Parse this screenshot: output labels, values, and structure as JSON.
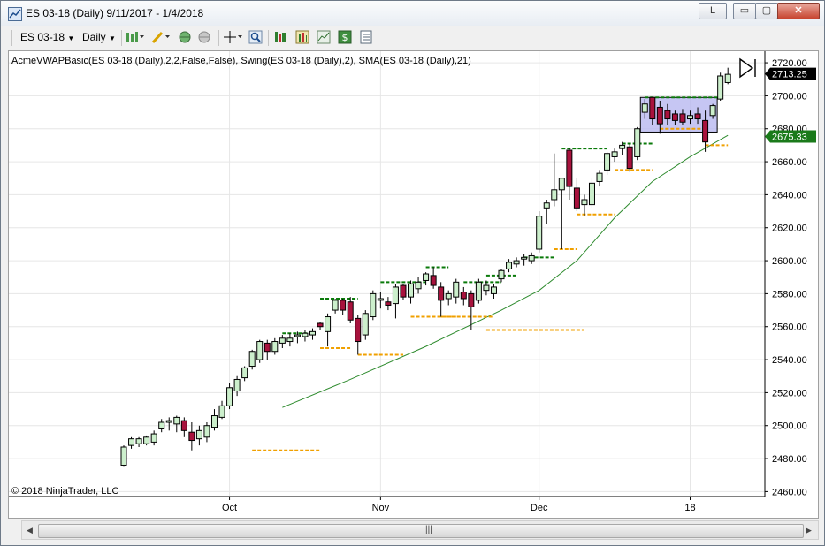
{
  "window": {
    "title": "ES 03-18 (Daily)  9/11/2017 - 1/4/2018",
    "link_button_label": "L",
    "minimize_label": "▭",
    "maximize_label": "▢",
    "close_label": "✕"
  },
  "toolbar": {
    "instrument": "ES 03-18",
    "interval": "Daily",
    "icons": [
      "bars-type-icon",
      "draw-pencil-icon",
      "globe-icon",
      "globe-gray-icon",
      "crosshair-icon",
      "zoom-icon",
      "strategy-icon",
      "properties-icon",
      "chart-trader-icon",
      "dollar-icon",
      "data-box-icon"
    ]
  },
  "chart": {
    "indicator_label": "AcmeVWAPBasic(ES 03-18 (Daily),2,2,False,False), Swing(ES 03-18 (Daily),2), SMA(ES 03-18 (Daily),21)",
    "copyright": "© 2018 NinjaTrader, LLC",
    "last_price_label": "2713.25",
    "sma_price_label": "2675.33",
    "colors": {
      "up_candle": "#ccefcc",
      "down_candle": "#a8123d",
      "swing_high": "#0a7a0a",
      "swing_low": "#f0a000",
      "sma": "#2e8b2e",
      "price_box": "#000000",
      "sma_box": "#1a7a1a",
      "highlight_rect": "#b8b8f0"
    }
  },
  "chart_data": {
    "type": "candlestick",
    "instrument": "ES 03-18",
    "interval": "Daily",
    "x_tick_labels": [
      "Oct",
      "Nov",
      "Dec",
      "18"
    ],
    "y_ticks": [
      2460,
      2480,
      2500,
      2520,
      2540,
      2560,
      2580,
      2600,
      2620,
      2640,
      2660,
      2680,
      2700,
      2720
    ],
    "y_tick_labels": [
      "2460.00",
      "2480.00",
      "2500.00",
      "2520.00",
      "2540.00",
      "2560.00",
      "2580.00",
      "2600.00",
      "2620.00",
      "2640.00",
      "2660.00",
      "2680.00",
      "2700.00",
      "2720.00"
    ],
    "ylim": [
      2457,
      2727
    ],
    "bars": [
      {
        "o": 2476,
        "h": 2488,
        "l": 2475,
        "c": 2487
      },
      {
        "o": 2488,
        "h": 2493,
        "l": 2486,
        "c": 2492
      },
      {
        "o": 2489,
        "h": 2493,
        "l": 2487,
        "c": 2492
      },
      {
        "o": 2489,
        "h": 2494,
        "l": 2488,
        "c": 2493
      },
      {
        "o": 2490,
        "h": 2497,
        "l": 2488,
        "c": 2495
      },
      {
        "o": 2498,
        "h": 2504,
        "l": 2496,
        "c": 2502
      },
      {
        "o": 2502,
        "h": 2505,
        "l": 2497,
        "c": 2503
      },
      {
        "o": 2501,
        "h": 2506,
        "l": 2496,
        "c": 2505
      },
      {
        "o": 2503,
        "h": 2505,
        "l": 2493,
        "c": 2497
      },
      {
        "o": 2496,
        "h": 2502,
        "l": 2485,
        "c": 2491
      },
      {
        "o": 2492,
        "h": 2500,
        "l": 2488,
        "c": 2497
      },
      {
        "o": 2493,
        "h": 2502,
        "l": 2490,
        "c": 2500
      },
      {
        "o": 2499,
        "h": 2510,
        "l": 2497,
        "c": 2506
      },
      {
        "o": 2505,
        "h": 2515,
        "l": 2504,
        "c": 2512
      },
      {
        "o": 2512,
        "h": 2526,
        "l": 2510,
        "c": 2523
      },
      {
        "o": 2521,
        "h": 2530,
        "l": 2518,
        "c": 2528
      },
      {
        "o": 2529,
        "h": 2536,
        "l": 2527,
        "c": 2535
      },
      {
        "o": 2536,
        "h": 2546,
        "l": 2534,
        "c": 2545
      },
      {
        "o": 2540,
        "h": 2552,
        "l": 2538,
        "c": 2551
      },
      {
        "o": 2550,
        "h": 2552,
        "l": 2540,
        "c": 2545
      },
      {
        "o": 2545,
        "h": 2553,
        "l": 2543,
        "c": 2551
      },
      {
        "o": 2550,
        "h": 2555,
        "l": 2547,
        "c": 2553
      },
      {
        "o": 2551,
        "h": 2556,
        "l": 2548,
        "c": 2553
      },
      {
        "o": 2554,
        "h": 2557,
        "l": 2550,
        "c": 2555
      },
      {
        "o": 2554,
        "h": 2558,
        "l": 2551,
        "c": 2556
      },
      {
        "o": 2555,
        "h": 2559,
        "l": 2552,
        "c": 2557
      },
      {
        "o": 2562,
        "h": 2563,
        "l": 2558,
        "c": 2560
      },
      {
        "o": 2557,
        "h": 2568,
        "l": 2548,
        "c": 2566
      },
      {
        "o": 2570,
        "h": 2577,
        "l": 2568,
        "c": 2576
      },
      {
        "o": 2576,
        "h": 2577,
        "l": 2567,
        "c": 2570
      },
      {
        "o": 2575,
        "h": 2578,
        "l": 2562,
        "c": 2564
      },
      {
        "o": 2565,
        "h": 2567,
        "l": 2543,
        "c": 2551
      },
      {
        "o": 2555,
        "h": 2570,
        "l": 2552,
        "c": 2568
      },
      {
        "o": 2566,
        "h": 2582,
        "l": 2564,
        "c": 2580
      },
      {
        "o": 2576,
        "h": 2581,
        "l": 2571,
        "c": 2577
      },
      {
        "o": 2575,
        "h": 2578,
        "l": 2570,
        "c": 2573
      },
      {
        "o": 2574,
        "h": 2586,
        "l": 2565,
        "c": 2584
      },
      {
        "o": 2585,
        "h": 2586,
        "l": 2576,
        "c": 2578
      },
      {
        "o": 2578,
        "h": 2588,
        "l": 2574,
        "c": 2586
      },
      {
        "o": 2583,
        "h": 2590,
        "l": 2580,
        "c": 2587
      },
      {
        "o": 2588,
        "h": 2593,
        "l": 2585,
        "c": 2592
      },
      {
        "o": 2591,
        "h": 2596,
        "l": 2583,
        "c": 2585
      },
      {
        "o": 2584,
        "h": 2587,
        "l": 2566,
        "c": 2576
      },
      {
        "o": 2577,
        "h": 2582,
        "l": 2573,
        "c": 2580
      },
      {
        "o": 2578,
        "h": 2589,
        "l": 2574,
        "c": 2587
      },
      {
        "o": 2581,
        "h": 2584,
        "l": 2573,
        "c": 2577
      },
      {
        "o": 2580,
        "h": 2582,
        "l": 2558,
        "c": 2572
      },
      {
        "o": 2576,
        "h": 2589,
        "l": 2574,
        "c": 2587
      },
      {
        "o": 2582,
        "h": 2588,
        "l": 2579,
        "c": 2585
      },
      {
        "o": 2580,
        "h": 2586,
        "l": 2577,
        "c": 2584
      },
      {
        "o": 2589,
        "h": 2595,
        "l": 2587,
        "c": 2594
      },
      {
        "o": 2595,
        "h": 2601,
        "l": 2593,
        "c": 2599
      },
      {
        "o": 2598,
        "h": 2602,
        "l": 2596,
        "c": 2600
      },
      {
        "o": 2601,
        "h": 2604,
        "l": 2597,
        "c": 2602
      },
      {
        "o": 2600,
        "h": 2605,
        "l": 2598,
        "c": 2603
      },
      {
        "o": 2607,
        "h": 2630,
        "l": 2605,
        "c": 2627
      },
      {
        "o": 2632,
        "h": 2637,
        "l": 2622,
        "c": 2635
      },
      {
        "o": 2637,
        "h": 2665,
        "l": 2633,
        "c": 2643
      },
      {
        "o": 2643,
        "h": 2648,
        "l": 2607,
        "c": 2650
      },
      {
        "o": 2667,
        "h": 2668,
        "l": 2637,
        "c": 2645
      },
      {
        "o": 2644,
        "h": 2650,
        "l": 2630,
        "c": 2632
      },
      {
        "o": 2634,
        "h": 2640,
        "l": 2627,
        "c": 2637
      },
      {
        "o": 2634,
        "h": 2650,
        "l": 2632,
        "c": 2647
      },
      {
        "o": 2648,
        "h": 2655,
        "l": 2645,
        "c": 2653
      },
      {
        "o": 2655,
        "h": 2666,
        "l": 2652,
        "c": 2665
      },
      {
        "o": 2663,
        "h": 2668,
        "l": 2660,
        "c": 2666
      },
      {
        "o": 2668,
        "h": 2672,
        "l": 2664,
        "c": 2670
      },
      {
        "o": 2669,
        "h": 2671,
        "l": 2654,
        "c": 2656
      },
      {
        "o": 2663,
        "h": 2681,
        "l": 2661,
        "c": 2680
      },
      {
        "o": 2690,
        "h": 2698,
        "l": 2686,
        "c": 2695
      },
      {
        "o": 2699,
        "h": 2699,
        "l": 2682,
        "c": 2686
      },
      {
        "o": 2693,
        "h": 2697,
        "l": 2677,
        "c": 2683
      },
      {
        "o": 2691,
        "h": 2695,
        "l": 2682,
        "c": 2686
      },
      {
        "o": 2689,
        "h": 2691,
        "l": 2682,
        "c": 2685
      },
      {
        "o": 2689,
        "h": 2692,
        "l": 2682,
        "c": 2684
      },
      {
        "o": 2686,
        "h": 2691,
        "l": 2683,
        "c": 2688
      },
      {
        "o": 2689,
        "h": 2693,
        "l": 2683,
        "c": 2686
      },
      {
        "o": 2685,
        "h": 2691,
        "l": 2666,
        "c": 2672
      },
      {
        "o": 2688,
        "h": 2695,
        "l": 2686,
        "c": 2694
      },
      {
        "o": 2698,
        "h": 2714,
        "l": 2697,
        "c": 2712
      },
      {
        "o": 2708,
        "h": 2717,
        "l": 2707,
        "c": 2713
      }
    ],
    "sma_21": [
      {
        "i": 21,
        "v": 2511
      },
      {
        "i": 30,
        "v": 2528
      },
      {
        "i": 40,
        "v": 2548
      },
      {
        "i": 50,
        "v": 2570
      },
      {
        "i": 55,
        "v": 2582
      },
      {
        "i": 60,
        "v": 2600
      },
      {
        "i": 65,
        "v": 2626
      },
      {
        "i": 70,
        "v": 2648
      },
      {
        "i": 75,
        "v": 2663
      },
      {
        "i": 80,
        "v": 2676
      }
    ],
    "swing_highs": [
      {
        "from": 21,
        "to": 25,
        "v": 2556
      },
      {
        "from": 26,
        "to": 31,
        "v": 2577
      },
      {
        "from": 34,
        "to": 40,
        "v": 2587
      },
      {
        "from": 40,
        "to": 43,
        "v": 2596
      },
      {
        "from": 45,
        "to": 50,
        "v": 2587
      },
      {
        "from": 48,
        "to": 52,
        "v": 2591
      },
      {
        "from": 53,
        "to": 57,
        "v": 2602
      },
      {
        "from": 58,
        "to": 64,
        "v": 2668
      },
      {
        "from": 66,
        "to": 70,
        "v": 2671
      },
      {
        "from": 69,
        "to": 79,
        "v": 2699
      }
    ],
    "swing_lows": [
      {
        "from": 17,
        "to": 26,
        "v": 2485
      },
      {
        "from": 26,
        "to": 30,
        "v": 2547
      },
      {
        "from": 31,
        "to": 37,
        "v": 2543
      },
      {
        "from": 38,
        "to": 44,
        "v": 2566
      },
      {
        "from": 42,
        "to": 49,
        "v": 2566
      },
      {
        "from": 48,
        "to": 61,
        "v": 2558
      },
      {
        "from": 57,
        "to": 60,
        "v": 2607
      },
      {
        "from": 60,
        "to": 65,
        "v": 2628
      },
      {
        "from": 65,
        "to": 70,
        "v": 2655
      },
      {
        "from": 71,
        "to": 77,
        "v": 2680
      },
      {
        "from": 77,
        "to": 80,
        "v": 2670
      }
    ],
    "highlight_region": {
      "from": 69,
      "to": 78,
      "y_low": 2678,
      "y_high": 2699
    }
  }
}
